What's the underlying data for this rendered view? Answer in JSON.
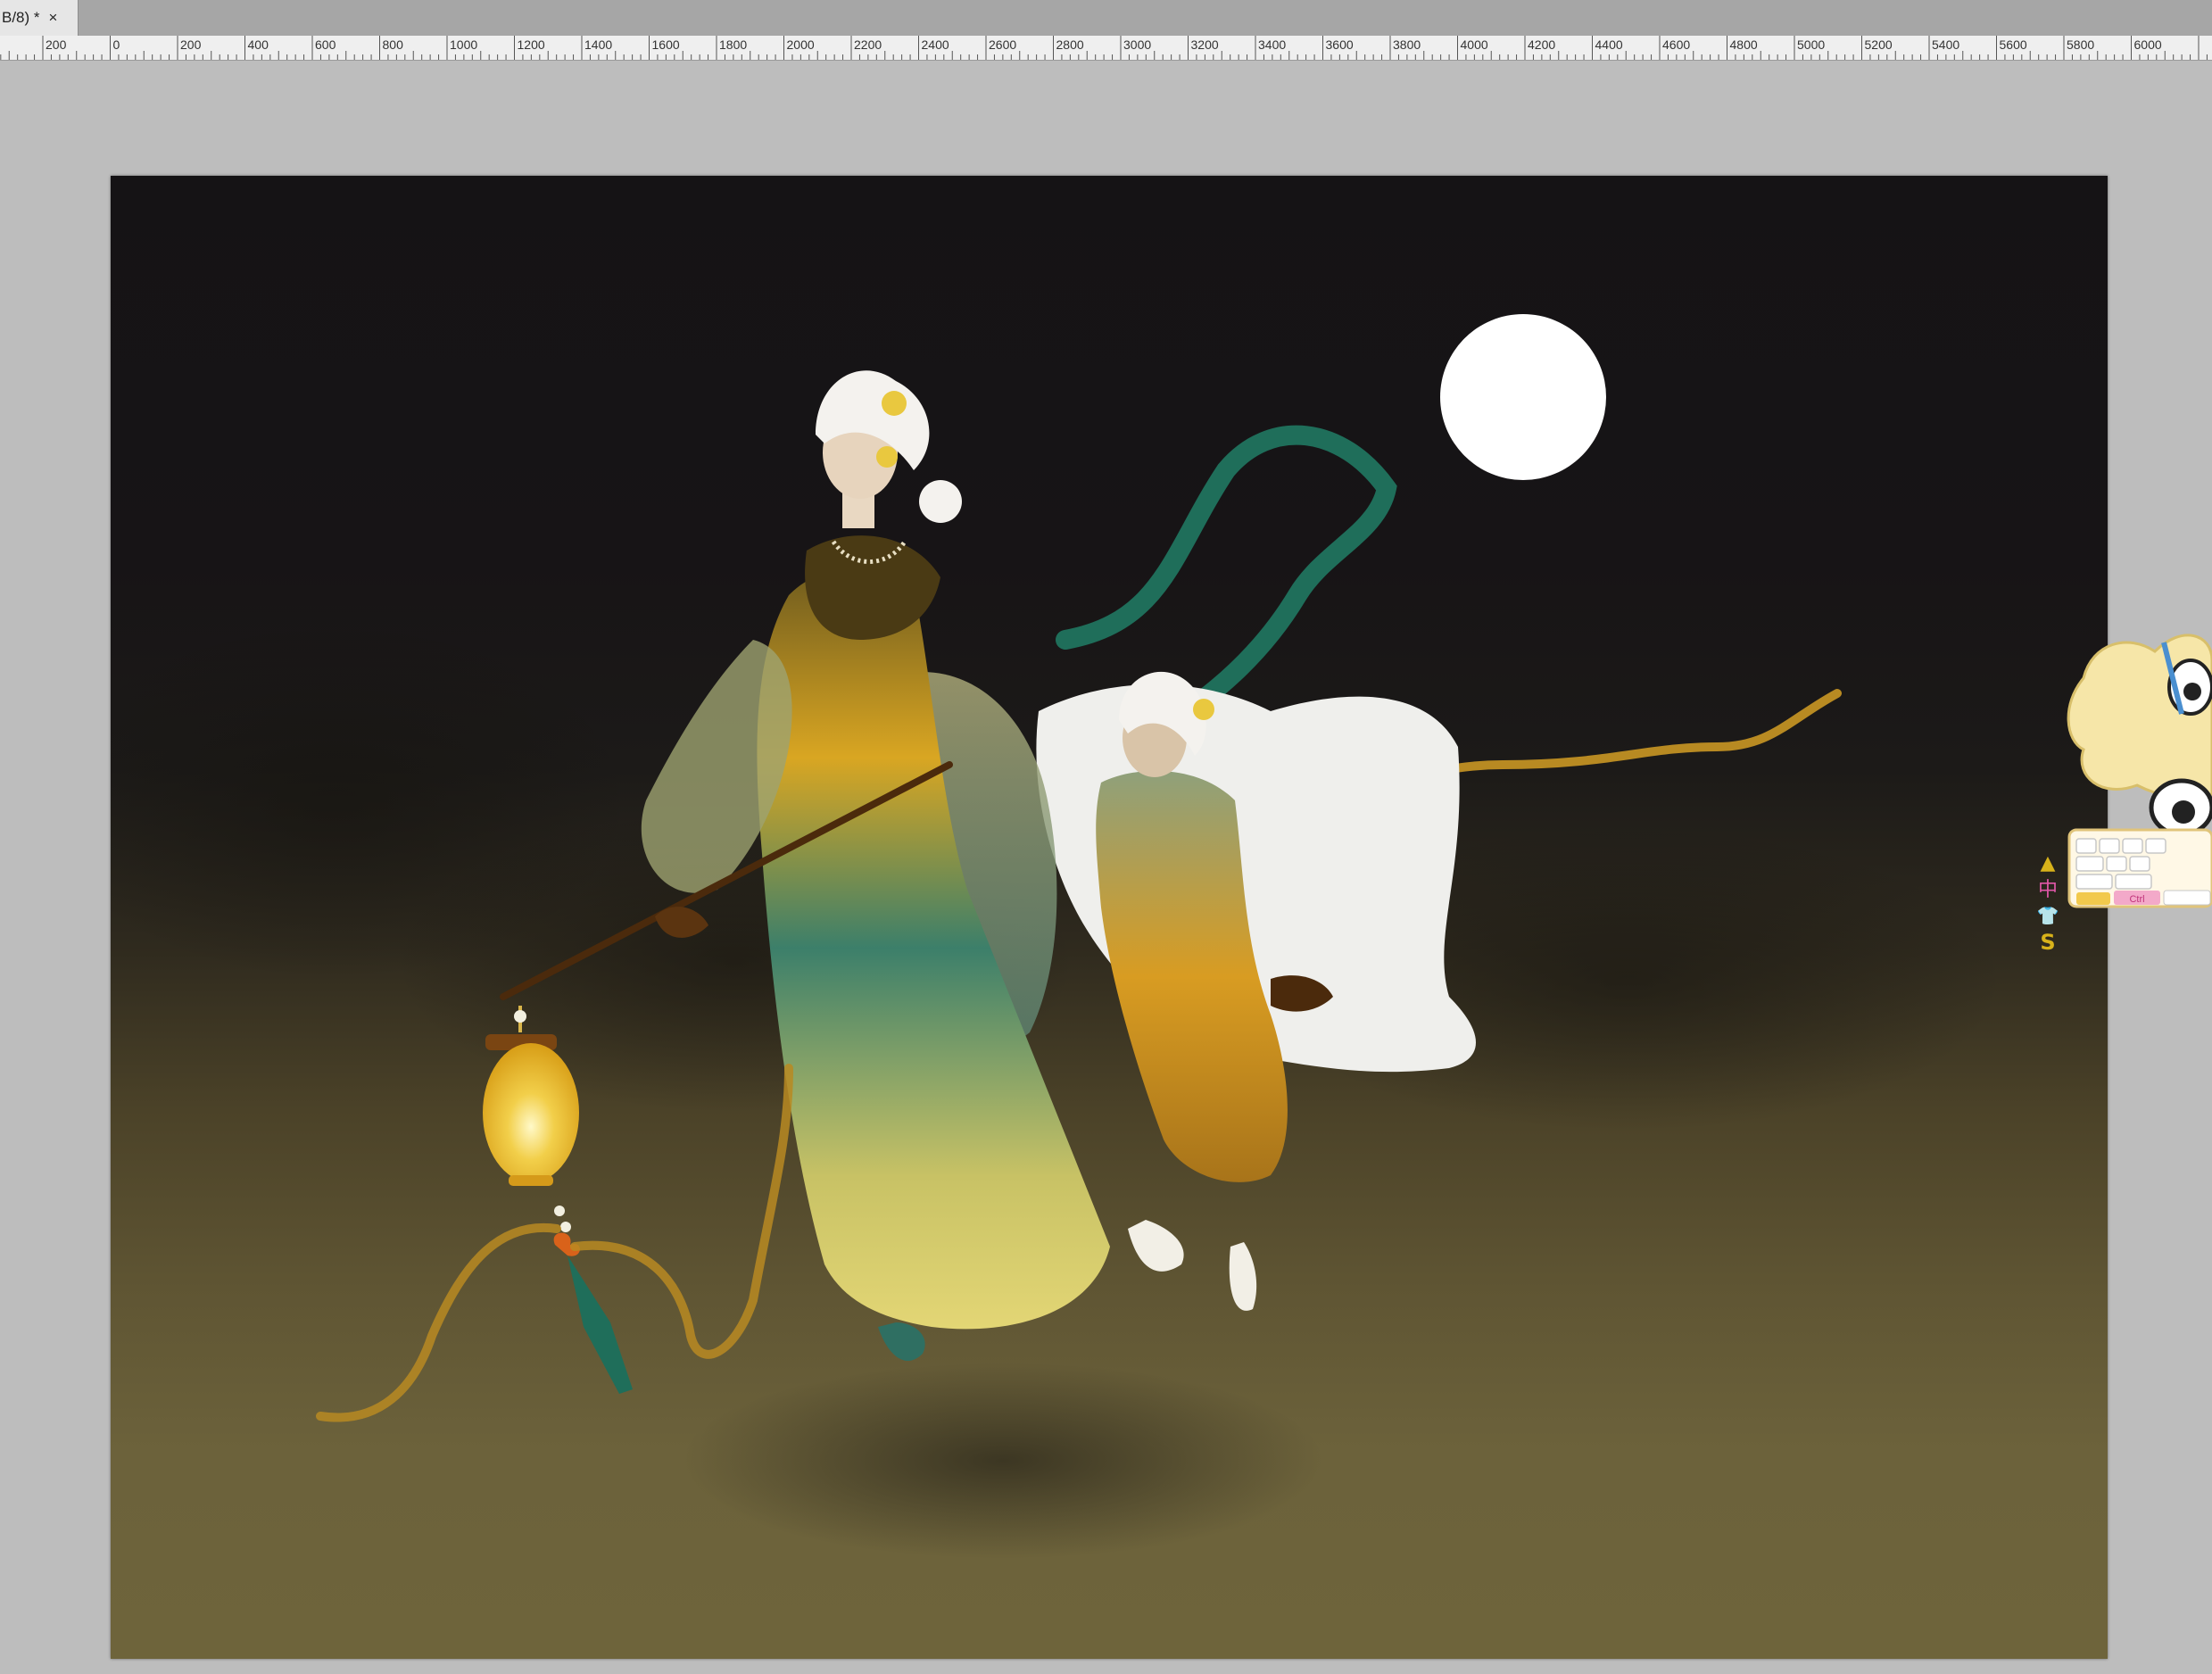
{
  "document_tab": {
    "label": "B/8) *",
    "close_glyph": "×"
  },
  "ruler": {
    "unit": "px",
    "labels": [
      "200",
      "0",
      "200",
      "400",
      "600",
      "800",
      "1000",
      "1200",
      "1400",
      "1600",
      "1800",
      "2000",
      "2200",
      "2400",
      "2600",
      "2800",
      "3000",
      "3200",
      "3400",
      "3600",
      "3800",
      "4000",
      "4200",
      "4400",
      "4600",
      "4800",
      "5000",
      "5200",
      "5400",
      "5600",
      "5800",
      "6000"
    ]
  },
  "canvas": {
    "subject": "illustration-two-figures-moon-lantern",
    "colors": {
      "sky": "#151315",
      "ground": "#6e643b",
      "moon": "#ffffff",
      "robe_green": "#3c7f6a",
      "robe_yellow": "#d9ab28",
      "ribbon_gold": "#b88a22",
      "ribbon_teal": "#1f6e5a"
    }
  },
  "ime_widget": {
    "buttons": [
      {
        "name": "arrow-up-icon",
        "glyph": "▲",
        "color": "#d8b21a"
      },
      {
        "name": "chinese-mode-icon",
        "glyph": "中",
        "color": "#e057a7"
      },
      {
        "name": "shirt-icon",
        "glyph": "👕",
        "color": "#3a8fd6"
      },
      {
        "name": "s-icon",
        "glyph": "S",
        "color": "#d8b21a"
      }
    ],
    "key_label": "Ctrl"
  }
}
